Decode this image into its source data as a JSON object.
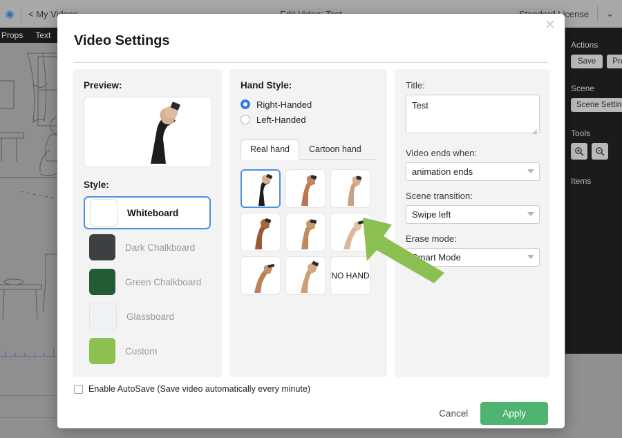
{
  "background": {
    "topbar": {
      "logo_icon": "app-logo-icon",
      "back_link": "< My Videos",
      "title": "Edit Video: Test",
      "license": "Standard License",
      "chevron_icon": "chevron-down-icon"
    },
    "left_tabs": [
      "Props",
      "Text"
    ],
    "right_panel": {
      "actions_header": "Actions",
      "save_label": "Save",
      "preview_label": "Prev",
      "scene_header": "Scene",
      "scene_settings_label": "Scene Setting",
      "tools_header": "Tools",
      "zoom_in_icon": "zoom-in-icon",
      "zoom_out_icon": "zoom-out-icon",
      "items_header": "Items"
    }
  },
  "modal": {
    "title": "Video Settings",
    "close_icon": "close-icon",
    "preview": {
      "label": "Preview:",
      "image_alt": "hand-with-marker-preview"
    },
    "style": {
      "label": "Style:",
      "selected": "Whiteboard",
      "options": [
        {
          "name": "Whiteboard",
          "color": "#ffffff",
          "selected": true
        },
        {
          "name": "Dark Chalkboard",
          "color": "#3c4042",
          "selected": false
        },
        {
          "name": "Green Chalkboard",
          "color": "#245c36",
          "selected": false
        },
        {
          "name": "Glassboard",
          "color": "#eff2f5",
          "selected": false
        },
        {
          "name": "Custom",
          "color": "#8cc152",
          "selected": false
        }
      ]
    },
    "hand_style": {
      "label": "Hand Style:",
      "handedness": {
        "selected": "Right-Handed",
        "options": [
          "Right-Handed",
          "Left-Handed"
        ]
      },
      "tabs": [
        {
          "label": "Real hand",
          "active": true
        },
        {
          "label": "Cartoon hand",
          "active": false
        }
      ],
      "hands": [
        {
          "id": "hand-1",
          "label": "",
          "selected": true,
          "skin": "#caa183",
          "sleeve": "#1d1d1d"
        },
        {
          "id": "hand-2",
          "label": "",
          "selected": false,
          "skin": "#b9784f",
          "sleeve": ""
        },
        {
          "id": "hand-3",
          "label": "",
          "selected": false,
          "skin": "#caa183",
          "sleeve": ""
        },
        {
          "id": "hand-4",
          "label": "",
          "selected": false,
          "skin": "#9a5a33",
          "sleeve": ""
        },
        {
          "id": "hand-5",
          "label": "",
          "selected": false,
          "skin": "#c08a5e",
          "sleeve": ""
        },
        {
          "id": "hand-6",
          "label": "",
          "selected": false,
          "skin": "#dcb79a",
          "sleeve": ""
        },
        {
          "id": "hand-7",
          "label": "",
          "selected": false,
          "skin": "#b8825a",
          "sleeve": ""
        },
        {
          "id": "hand-8",
          "label": "",
          "selected": false,
          "skin": "#c99e79",
          "sleeve": ""
        },
        {
          "id": "hand-9",
          "label": "NO HAND",
          "selected": false,
          "skin": "",
          "sleeve": ""
        }
      ]
    },
    "settings": {
      "title_label": "Title:",
      "title_value": "Test",
      "video_ends_label": "Video ends when:",
      "video_ends_value": "animation ends",
      "scene_transition_label": "Scene transition:",
      "scene_transition_value": "Swipe left",
      "erase_mode_label": "Erase mode:",
      "erase_mode_value": "Smart Mode"
    },
    "autosave": {
      "checked": false,
      "label": "Enable AutoSave (Save video automatically every minute)"
    },
    "footer": {
      "cancel_label": "Cancel",
      "apply_label": "Apply"
    }
  },
  "annotation": {
    "arrow_color": "#8cbf52",
    "arrow_name": "green-pointer-arrow"
  }
}
